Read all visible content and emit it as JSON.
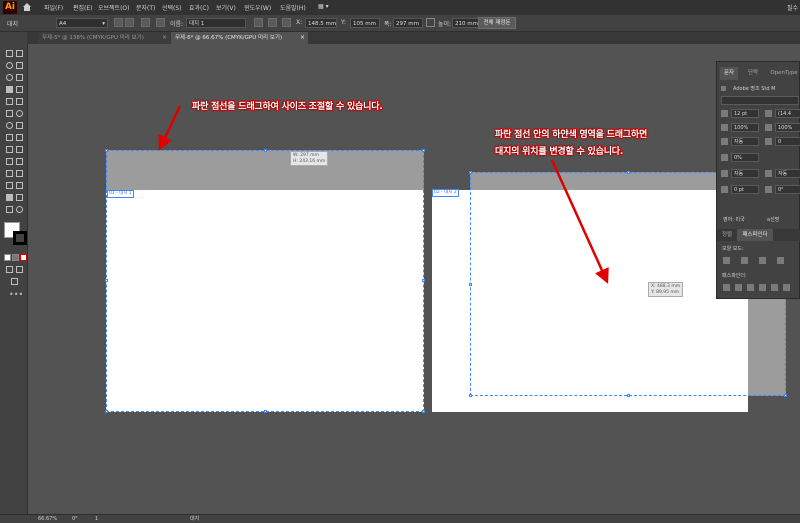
{
  "app": {
    "logo": "Ai",
    "menu": [
      "파일(F)",
      "편집(E)",
      "오브젝트(O)",
      "문자(T)",
      "선택(S)",
      "효과(C)",
      "보기(V)",
      "윈도우(W)",
      "도움말(H)"
    ],
    "workspace_label": "필수"
  },
  "control_bar": {
    "mode_label": "대지",
    "preset_value": "A4",
    "name_label": "이름:",
    "name_value": "대지 1",
    "x_label": "X:",
    "x_value": "148.5 mm",
    "y_label": "Y:",
    "y_value": "105 mm",
    "w_label": "폭:",
    "w_value": "297 mm",
    "h_label": "높이:",
    "h_value": "210 mm",
    "rearrange_button": "전체 재정돈"
  },
  "tabs": [
    {
      "label": "무제-5* @ 138% (CMYK/GPU 미리 보기)",
      "close": "×",
      "active": false
    },
    {
      "label": "무제-6* @ 66.67% (CMYK/GPU 미리 보기)",
      "close": "×",
      "active": true
    }
  ],
  "canvas": {
    "artboard1": {
      "label": "01 - 대지 1",
      "readout_w": "W: 297 mm",
      "readout_h": "H: 243.16 mm"
    },
    "artboard2": {
      "label": "02 - 대지 2",
      "readout_x": "X: 488.3 mm",
      "readout_y": "Y: 89.95 mm"
    },
    "annotations": {
      "resize": "파란 점선을 드래그하여 사이즈 조절할 수 있습니다.",
      "move_line1": "파란 점선 안의 하얀색 영역을 드래그하면",
      "move_line2": "대지의 위치를 변경할 수 있습니다."
    },
    "annotation_color": "#ff0000",
    "selection_color": "#3f88ff"
  },
  "char_panel": {
    "tabs": [
      "문자",
      "단락",
      "OpenType"
    ],
    "font_family": "Adobe 명조 Std M",
    "font_size": "12 pt",
    "leading": "(14.4",
    "scale_v": "100%",
    "scale_h": "100%",
    "kerning": "자동",
    "tracking": "0",
    "tsume": "0%",
    "auto1": "자동",
    "auto2": "자동",
    "baseline": "0 pt",
    "rotation": "0°",
    "language": "영어: 미국",
    "sharp": "선명"
  },
  "pathfinder_panel": {
    "tabs": [
      "정렬",
      "패스파인더"
    ],
    "shape_mode_label": "모양 모드:",
    "pathfinder_label": "패스파인더:"
  },
  "status_bar": {
    "zoom": "66.67%",
    "rotate": "0°",
    "page": "1",
    "mode": "대지"
  }
}
